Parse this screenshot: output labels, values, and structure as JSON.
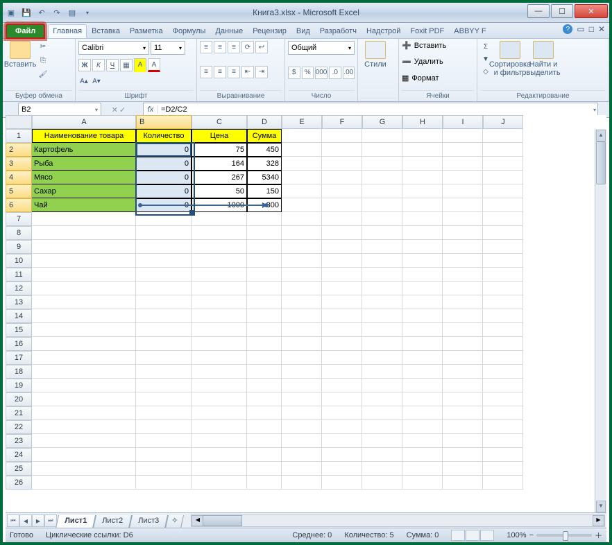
{
  "title": {
    "filename": "Книга3.xlsx",
    "appname": " -  Microsoft Excel"
  },
  "tabs": {
    "file": "Файл",
    "items": [
      "Главная",
      "Вставка",
      "Разметка",
      "Формулы",
      "Данные",
      "Рецензир",
      "Вид",
      "Разработч",
      "Надстрой",
      "Foxit PDF",
      "ABBYY F"
    ]
  },
  "ribbon": {
    "clipboard": {
      "paste": "Вставить",
      "label": "Буфер обмена"
    },
    "font": {
      "name": "Calibri",
      "size": "11",
      "label": "Шрифт",
      "bold": "Ж",
      "italic": "К",
      "underline": "Ч"
    },
    "align": {
      "label": "Выравнивание"
    },
    "number": {
      "format": "Общий",
      "label": "Число"
    },
    "styles": {
      "btn": "Стили"
    },
    "cells": {
      "insert": "Вставить",
      "delete": "Удалить",
      "format": "Формат",
      "label": "Ячейки"
    },
    "edit": {
      "sort": "Сортировка и фильтр",
      "find": "Найти и выделить",
      "label": "Редактирование"
    }
  },
  "namebox": "B2",
  "formula": "=D2/C2",
  "columns": [
    "A",
    "B",
    "C",
    "D",
    "E",
    "F",
    "G",
    "H",
    "I",
    "J"
  ],
  "headers": {
    "a": "Наименование товара",
    "b": "Количество",
    "c": "Цена",
    "d": "Сумма"
  },
  "rows": [
    {
      "name": "Картофель",
      "qty": "0",
      "price": "75",
      "sum": "450"
    },
    {
      "name": "Рыба",
      "qty": "0",
      "price": "164",
      "sum": "328"
    },
    {
      "name": "Мясо",
      "qty": "0",
      "price": "267",
      "sum": "5340"
    },
    {
      "name": "Сахар",
      "qty": "0",
      "price": "50",
      "sum": "150"
    },
    {
      "name": "Чай",
      "qty": "0",
      "price": "1000",
      "sum": "300"
    }
  ],
  "sheets": [
    "Лист1",
    "Лист2",
    "Лист3"
  ],
  "status": {
    "ready": "Готово",
    "cycl": "Циклические ссылки: D6",
    "avg": "Среднее: 0",
    "count": "Количество: 5",
    "sum": "Сумма: 0",
    "zoom": "100%"
  }
}
